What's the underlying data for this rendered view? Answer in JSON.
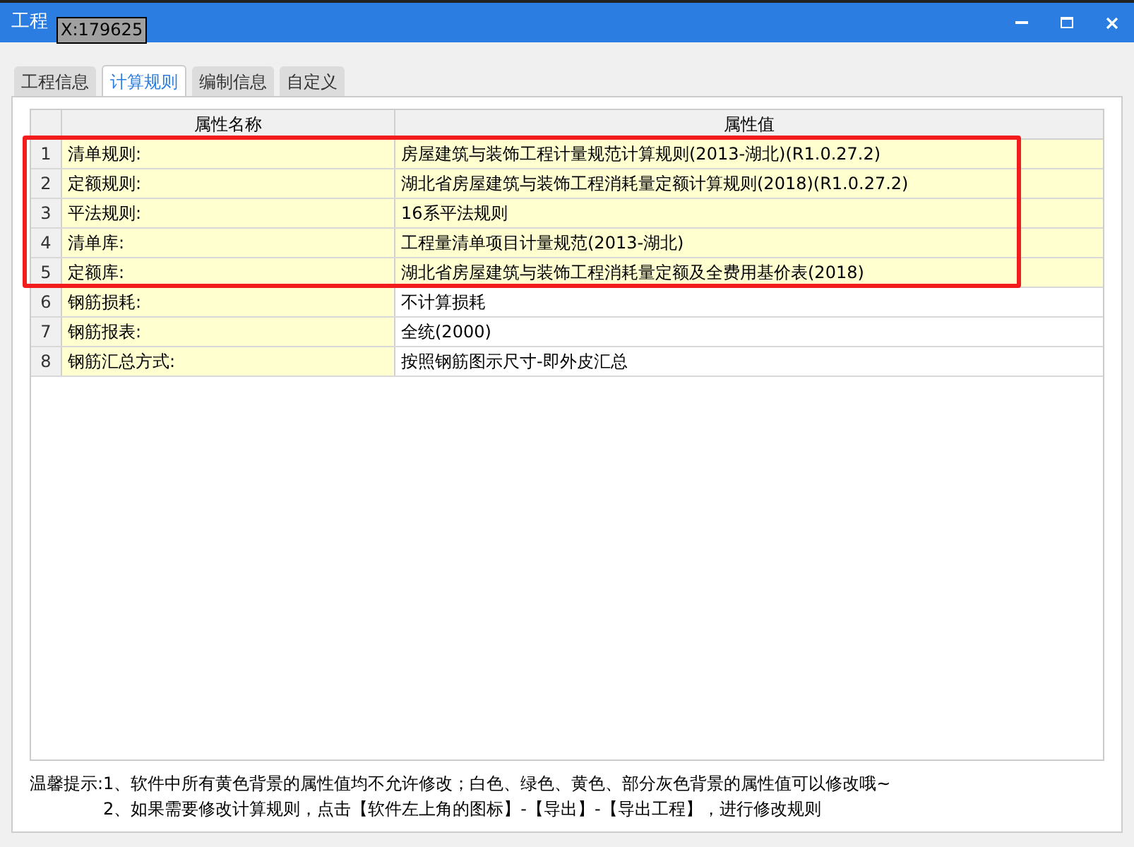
{
  "window": {
    "title": "工程",
    "tooltip": "X:179625"
  },
  "tabs": [
    {
      "label": "工程信息",
      "selected": false
    },
    {
      "label": "计算规则",
      "selected": true
    },
    {
      "label": "编制信息",
      "selected": false
    },
    {
      "label": "自定义",
      "selected": false
    }
  ],
  "table": {
    "columns": [
      "属性名称",
      "属性值"
    ],
    "rows": [
      {
        "index": "1",
        "name": "清单规则:",
        "value": "房屋建筑与装饰工程计量规范计算规则(2013-湖北)(R1.0.27.2)",
        "locked": true
      },
      {
        "index": "2",
        "name": "定额规则:",
        "value": "湖北省房屋建筑与装饰工程消耗量定额计算规则(2018)(R1.0.27.2)",
        "locked": true
      },
      {
        "index": "3",
        "name": "平法规则:",
        "value": "16系平法规则",
        "locked": true
      },
      {
        "index": "4",
        "name": "清单库:",
        "value": "工程量清单项目计量规范(2013-湖北)",
        "locked": true
      },
      {
        "index": "5",
        "name": "定额库:",
        "value": "湖北省房屋建筑与装饰工程消耗量定额及全费用基价表(2018)",
        "locked": true
      },
      {
        "index": "6",
        "name": "钢筋损耗:",
        "value": "不计算损耗",
        "locked": false
      },
      {
        "index": "7",
        "name": "钢筋报表:",
        "value": "全统(2000)",
        "locked": false
      },
      {
        "index": "8",
        "name": "钢筋汇总方式:",
        "value": "按照钢筋图示尺寸-即外皮汇总",
        "locked": false
      }
    ]
  },
  "tips": [
    "温馨提示:1、软件中所有黄色背景的属性值均不允许修改；白色、绿色、黄色、部分灰色背景的属性值可以修改哦~",
    "2、如果需要修改计算规则，点击【软件左上角的图标】-【导出】-【导出工程】，进行修改规则"
  ]
}
